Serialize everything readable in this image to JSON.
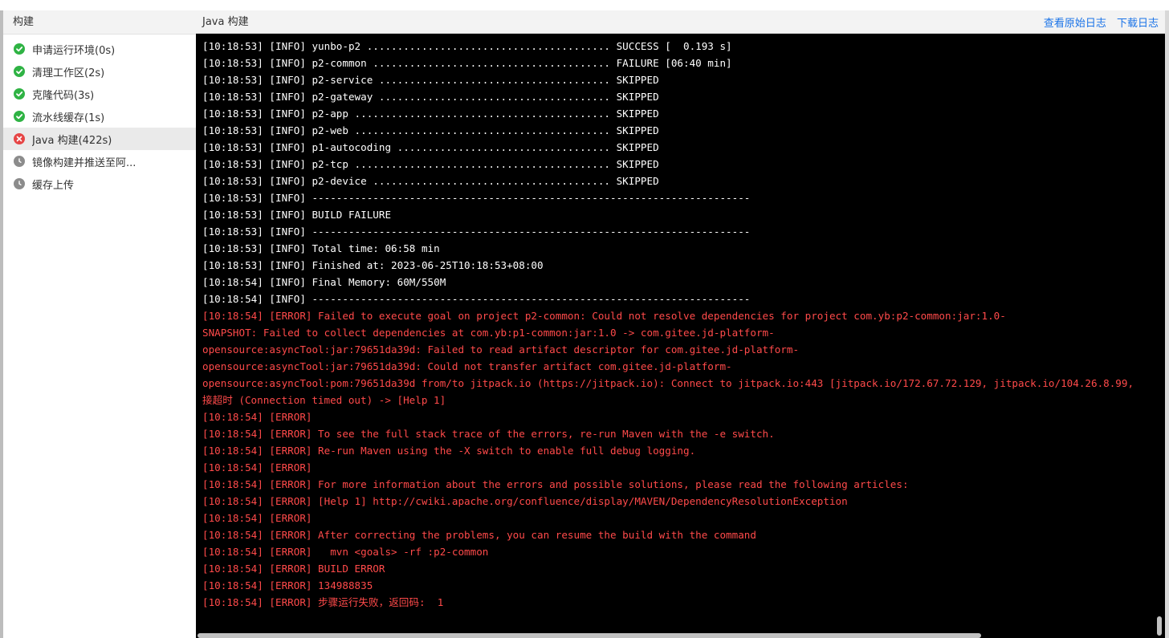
{
  "sidebar": {
    "title": "构建",
    "steps": [
      {
        "label": "申请运行环境(0s)",
        "status": "success",
        "icon": "check-circle-icon"
      },
      {
        "label": "清理工作区(2s)",
        "status": "success",
        "icon": "check-circle-icon"
      },
      {
        "label": "克隆代码(3s)",
        "status": "success",
        "icon": "check-circle-icon"
      },
      {
        "label": "流水线缓存(1s)",
        "status": "success",
        "icon": "check-circle-icon"
      },
      {
        "label": "Java 构建(422s)",
        "status": "failed",
        "icon": "error-circle-icon"
      },
      {
        "label": "镜像构建并推送至阿...",
        "status": "pending",
        "icon": "clock-icon"
      },
      {
        "label": "缓存上传",
        "status": "pending",
        "icon": "clock-icon"
      }
    ]
  },
  "log_panel": {
    "title": "Java 构建",
    "view_raw_label": "查看原始日志",
    "download_label": "下载日志",
    "lines": [
      {
        "text": "[10:18:53] [INFO] yunbo-p2 ........................................ SUCCESS [  0.193 s]",
        "level": "info"
      },
      {
        "text": "[10:18:53] [INFO] p2-common ....................................... FAILURE [06:40 min]",
        "level": "info"
      },
      {
        "text": "[10:18:53] [INFO] p2-service ...................................... SKIPPED",
        "level": "info"
      },
      {
        "text": "[10:18:53] [INFO] p2-gateway ...................................... SKIPPED",
        "level": "info"
      },
      {
        "text": "[10:18:53] [INFO] p2-app .......................................... SKIPPED",
        "level": "info"
      },
      {
        "text": "[10:18:53] [INFO] p2-web .......................................... SKIPPED",
        "level": "info"
      },
      {
        "text": "[10:18:53] [INFO] p1-autocoding ................................... SKIPPED",
        "level": "info"
      },
      {
        "text": "[10:18:53] [INFO] p2-tcp .......................................... SKIPPED",
        "level": "info"
      },
      {
        "text": "[10:18:53] [INFO] p2-device ....................................... SKIPPED",
        "level": "info"
      },
      {
        "text": "[10:18:53] [INFO] ------------------------------------------------------------------------",
        "level": "info"
      },
      {
        "text": "[10:18:53] [INFO] BUILD FAILURE",
        "level": "info"
      },
      {
        "text": "[10:18:53] [INFO] ------------------------------------------------------------------------",
        "level": "info"
      },
      {
        "text": "[10:18:53] [INFO] Total time: 06:58 min",
        "level": "info"
      },
      {
        "text": "[10:18:53] [INFO] Finished at: 2023-06-25T10:18:53+08:00",
        "level": "info"
      },
      {
        "text": "[10:18:54] [INFO] Final Memory: 60M/550M",
        "level": "info"
      },
      {
        "text": "[10:18:54] [INFO] ------------------------------------------------------------------------",
        "level": "info"
      },
      {
        "text": "[10:18:54] [ERROR] Failed to execute goal on project p2-common: Could not resolve dependencies for project com.yb:p2-common:jar:1.0-",
        "level": "error"
      },
      {
        "text": "SNAPSHOT: Failed to collect dependencies at com.yb:p1-common:jar:1.0 -> com.gitee.jd-platform-",
        "level": "error"
      },
      {
        "text": "opensource:asyncTool:jar:79651da39d: Failed to read artifact descriptor for com.gitee.jd-platform-",
        "level": "error"
      },
      {
        "text": "opensource:asyncTool:jar:79651da39d: Could not transfer artifact com.gitee.jd-platform-",
        "level": "error"
      },
      {
        "text": "opensource:asyncTool:pom:79651da39d from/to jitpack.io (https://jitpack.io): Connect to jitpack.io:443 [jitpack.io/172.67.72.129, jitpack.io/104.26.8.99,",
        "level": "error"
      },
      {
        "text": "接超时 (Connection timed out) -> [Help 1]",
        "level": "error"
      },
      {
        "text": "[10:18:54] [ERROR]",
        "level": "error"
      },
      {
        "text": "[10:18:54] [ERROR] To see the full stack trace of the errors, re-run Maven with the -e switch.",
        "level": "error"
      },
      {
        "text": "[10:18:54] [ERROR] Re-run Maven using the -X switch to enable full debug logging.",
        "level": "error"
      },
      {
        "text": "[10:18:54] [ERROR]",
        "level": "error"
      },
      {
        "text": "[10:18:54] [ERROR] For more information about the errors and possible solutions, please read the following articles:",
        "level": "error"
      },
      {
        "text": "[10:18:54] [ERROR] [Help 1] http://cwiki.apache.org/confluence/display/MAVEN/DependencyResolutionException",
        "level": "error"
      },
      {
        "text": "[10:18:54] [ERROR]",
        "level": "error"
      },
      {
        "text": "[10:18:54] [ERROR] After correcting the problems, you can resume the build with the command",
        "level": "error"
      },
      {
        "text": "[10:18:54] [ERROR]   mvn <goals> -rf :p2-common",
        "level": "error"
      },
      {
        "text": "[10:18:54] [ERROR] BUILD ERROR",
        "level": "error"
      },
      {
        "text": "[10:18:54] [ERROR] 134988835",
        "level": "error"
      },
      {
        "text": "[10:18:54] [ERROR] 步骤运行失败，返回码:  1",
        "level": "error"
      }
    ]
  },
  "colors": {
    "success": "#2fb344",
    "error": "#e64545",
    "pending": "#8c8c8c",
    "link": "#1a73e8",
    "log_error_text": "#ff4a4a",
    "log_background": "#000000"
  }
}
